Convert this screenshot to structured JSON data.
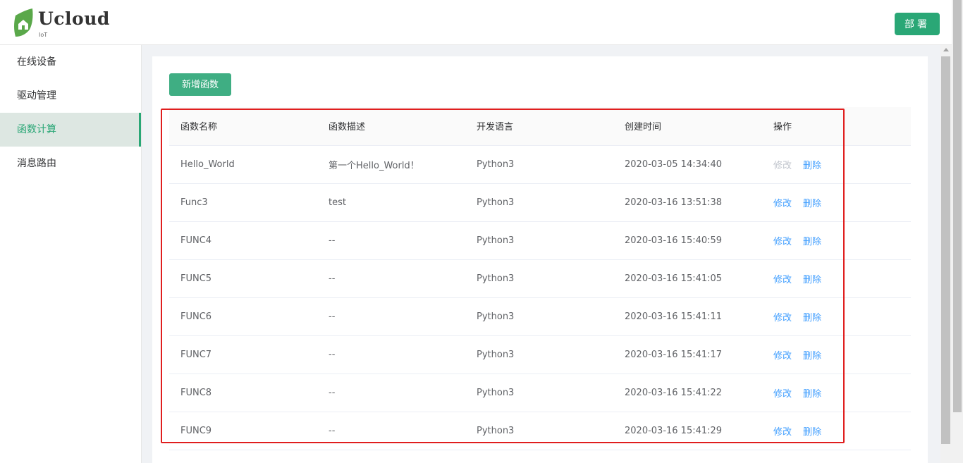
{
  "header": {
    "brand": "Ucloud",
    "brand_sub": "IoT",
    "deploy_label": "部署"
  },
  "sidebar": {
    "items": [
      {
        "label": "在线设备",
        "active": false
      },
      {
        "label": "驱动管理",
        "active": false
      },
      {
        "label": "函数计算",
        "active": true
      },
      {
        "label": "消息路由",
        "active": false
      }
    ]
  },
  "main": {
    "add_label": "新增函数",
    "columns": [
      "函数名称",
      "函数描述",
      "开发语言",
      "创建时间",
      "操作"
    ],
    "rows": [
      {
        "name": "Hello_World",
        "desc": "第一个Hello_World！",
        "lang": "Python3",
        "time": "2020-03-05 14:34:40",
        "edit": "修改",
        "delete": "删除",
        "edit_disabled": true
      },
      {
        "name": "Func3",
        "desc": "test",
        "lang": "Python3",
        "time": "2020-03-16 13:51:38",
        "edit": "修改",
        "delete": "删除",
        "edit_disabled": false
      },
      {
        "name": "FUNC4",
        "desc": "--",
        "lang": "Python3",
        "time": "2020-03-16 15:40:59",
        "edit": "修改",
        "delete": "删除",
        "edit_disabled": false
      },
      {
        "name": "FUNC5",
        "desc": "--",
        "lang": "Python3",
        "time": "2020-03-16 15:41:05",
        "edit": "修改",
        "delete": "删除",
        "edit_disabled": false
      },
      {
        "name": "FUNC6",
        "desc": "--",
        "lang": "Python3",
        "time": "2020-03-16 15:41:11",
        "edit": "修改",
        "delete": "删除",
        "edit_disabled": false
      },
      {
        "name": "FUNC7",
        "desc": "--",
        "lang": "Python3",
        "time": "2020-03-16 15:41:17",
        "edit": "修改",
        "delete": "删除",
        "edit_disabled": false
      },
      {
        "name": "FUNC8",
        "desc": "--",
        "lang": "Python3",
        "time": "2020-03-16 15:41:22",
        "edit": "修改",
        "delete": "删除",
        "edit_disabled": false
      },
      {
        "name": "FUNC9",
        "desc": "--",
        "lang": "Python3",
        "time": "2020-03-16 15:41:29",
        "edit": "修改",
        "delete": "删除",
        "edit_disabled": false
      }
    ]
  },
  "colors": {
    "accent": "#2aa776",
    "link": "#409eff",
    "highlight_box": "#e01e1e"
  }
}
